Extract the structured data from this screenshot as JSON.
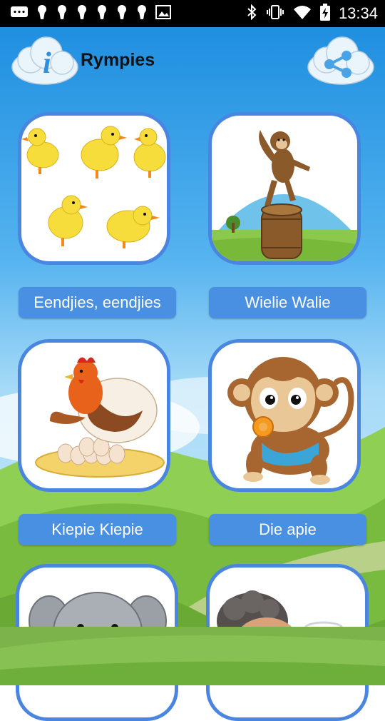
{
  "status_bar": {
    "time": "13:34",
    "left_icons": [
      "message-icon",
      "keyhole-icon",
      "keyhole-icon",
      "keyhole-icon",
      "keyhole-icon",
      "keyhole-icon",
      "keyhole-icon",
      "image-icon"
    ],
    "right_icons": [
      "bluetooth-icon",
      "vibrate-icon",
      "wifi-icon",
      "battery-charging-icon"
    ]
  },
  "header": {
    "title": "Rympies",
    "info_icon": "info-icon",
    "share_icon": "share-icon"
  },
  "songs": [
    {
      "label": "Eendjies, eendjies",
      "image": "ducklings"
    },
    {
      "label": "Wielie Walie",
      "image": "monkey-on-barrel"
    },
    {
      "label": "Kiepie Kiepie",
      "image": "hen-with-eggs"
    },
    {
      "label": "Die apie",
      "image": "baby-monkey"
    },
    {
      "label": "",
      "image": "elephant"
    },
    {
      "label": "",
      "image": "grandmother"
    }
  ],
  "colors": {
    "accent": "#4a90e2",
    "card_border": "#4a86e0",
    "sky_top": "#1f8fe0",
    "grass": "#7cb34a"
  }
}
